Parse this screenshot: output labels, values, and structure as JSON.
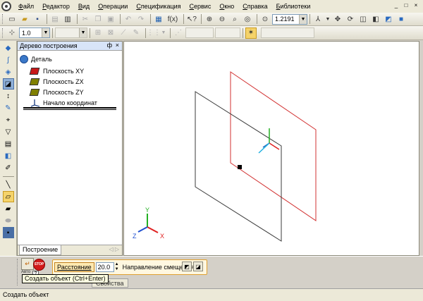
{
  "menu": {
    "items": [
      "Файл",
      "Редактор",
      "Вид",
      "Операции",
      "Спецификация",
      "Сервис",
      "Окно",
      "Справка",
      "Библиотеки"
    ],
    "window_buttons": [
      "_",
      "□",
      "×"
    ]
  },
  "toolbar1": {
    "fx_label": "f(x)",
    "zoom_value": "1.2191"
  },
  "toolbar2": {
    "step_value": "1.0"
  },
  "tree_panel": {
    "title": "Дерево построения",
    "pin_label": "ф",
    "close_label": "×",
    "root_label": "Деталь",
    "items": [
      {
        "label": "Плоскость XY",
        "color": "#c81818"
      },
      {
        "label": "Плоскость ZX",
        "color": "#808000"
      },
      {
        "label": "Плоскость ZY",
        "color": "#808000"
      },
      {
        "label": "Начало координат"
      }
    ],
    "tab_label": "Построение",
    "tab_arrows": "◁ ▷"
  },
  "canvas": {
    "axis_labels": {
      "x": "X",
      "y": "Y",
      "z": "Z"
    }
  },
  "properties": {
    "auto_label": "Авто",
    "stop_label": "STOP",
    "distance_label": "Расстояние",
    "distance_value": "20.0",
    "direction_label": "Направление смещения",
    "props_tab_label": "Свойства"
  },
  "tooltip": "Создать объект (Ctrl+Enter)",
  "status": "Создать объект",
  "colors": {
    "red_plane": "#d23232",
    "dark_plane": "#3a3a3a",
    "origin_x": "#e02020",
    "origin_y": "#22b022",
    "origin_z": "#2050d0"
  }
}
